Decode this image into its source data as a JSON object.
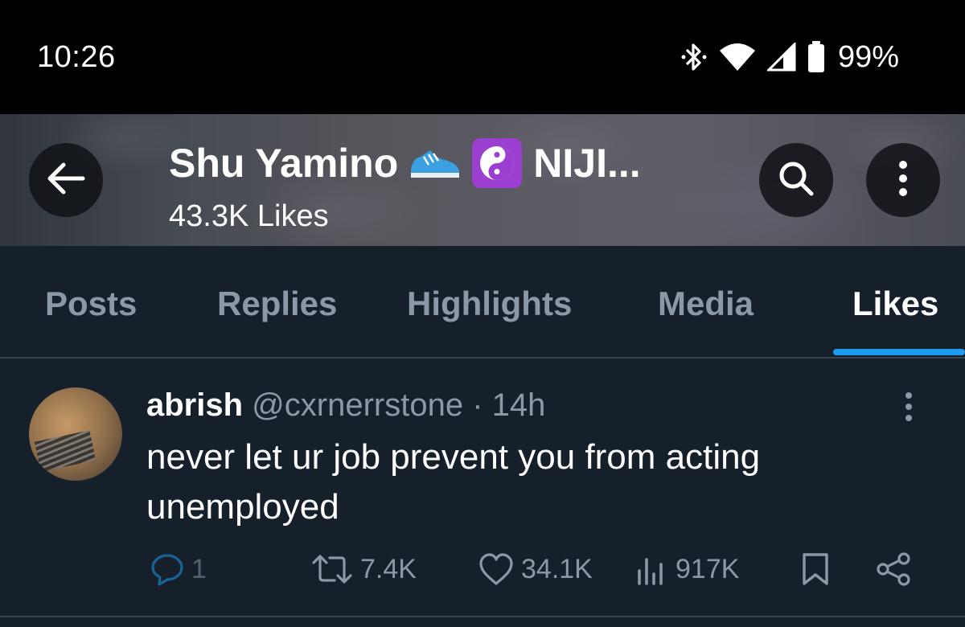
{
  "status_bar": {
    "time": "10:26",
    "battery_percent": "99%",
    "icons": [
      "bluetooth-icon",
      "wifi-icon",
      "cell-signal-icon",
      "battery-icon"
    ]
  },
  "header": {
    "profile_name": "Shu Yamino",
    "profile_name_suffix": "NIJI...",
    "emoji": [
      "running-shoe-emoji",
      "yin-yang-emoji"
    ],
    "likes_count": "43.3K Likes"
  },
  "tabs": [
    {
      "label": "Posts",
      "active": false
    },
    {
      "label": "Replies",
      "active": false
    },
    {
      "label": "Highlights",
      "active": false
    },
    {
      "label": "Media",
      "active": false
    },
    {
      "label": "Likes",
      "active": true
    }
  ],
  "tweet": {
    "display_name": "abrish",
    "handle": "@cxrnerrstone",
    "separator": "·",
    "time": "14h",
    "text_line1": "never let ur job prevent you from acting",
    "text_line2": "unemployed",
    "actions": {
      "replies": "1",
      "reposts": "7.4K",
      "likes": "34.1K",
      "views": "917K"
    }
  },
  "colors": {
    "background": "#15202b",
    "accent": "#1d9bf0",
    "muted_text": "#8b98a5",
    "divider": "#38444d"
  }
}
